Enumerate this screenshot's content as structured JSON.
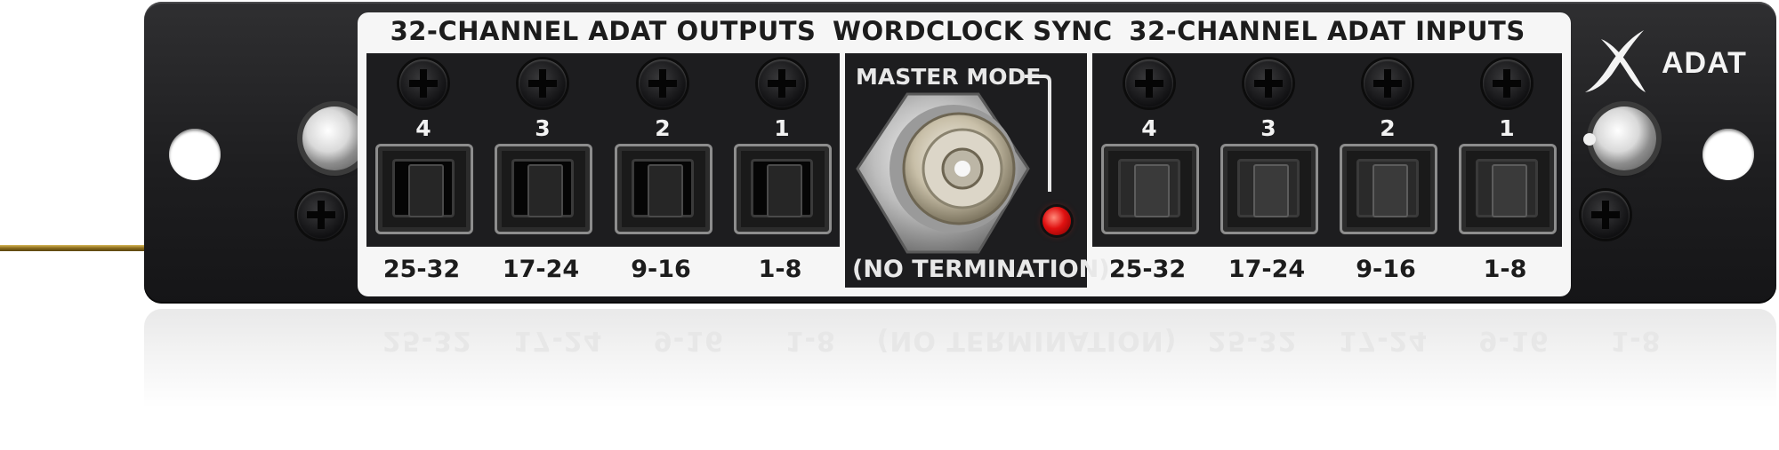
{
  "outputs": {
    "title": "32-CHANNEL ADAT OUTPUTS",
    "ports": [
      {
        "number": "4",
        "range": "25-32"
      },
      {
        "number": "3",
        "range": "17-24"
      },
      {
        "number": "2",
        "range": "9-16"
      },
      {
        "number": "1",
        "range": "1-8"
      }
    ]
  },
  "wordclock": {
    "title": "WORDCLOCK SYNC",
    "master_mode": "MASTER MODE",
    "termination": "(NO TERMINATION)"
  },
  "inputs": {
    "title": "32-CHANNEL ADAT INPUTS",
    "ports": [
      {
        "number": "4",
        "range": "25-32"
      },
      {
        "number": "3",
        "range": "17-24"
      },
      {
        "number": "2",
        "range": "9-16"
      },
      {
        "number": "1",
        "range": "1-8"
      }
    ]
  },
  "logo": {
    "mark": "X",
    "text": "ADAT"
  },
  "colors": {
    "panel": "#1e1e20",
    "label_band": "#f6f6f6",
    "led": "#e01010",
    "wire": "#8a6b1c"
  }
}
